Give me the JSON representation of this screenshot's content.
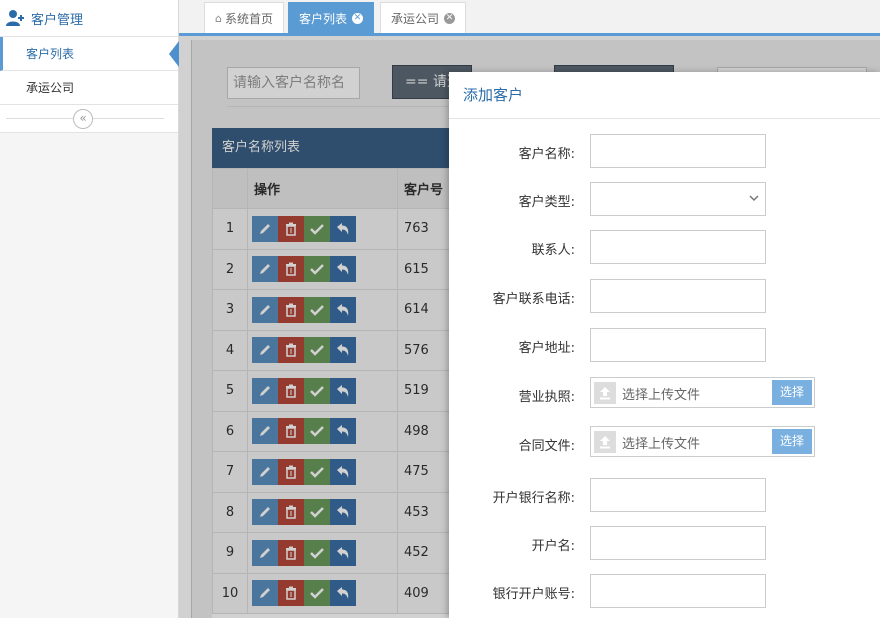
{
  "sidebar": {
    "header": "客户管理",
    "items": [
      {
        "label": "客户列表",
        "active": true
      },
      {
        "label": "承运公司",
        "active": false
      }
    ],
    "collapse_glyph": "«"
  },
  "tabs": [
    {
      "label": "系统首页",
      "icon": "home-icon"
    },
    {
      "label": "客户列表",
      "active": true
    },
    {
      "label": "承运公司"
    }
  ],
  "toolbar": {
    "search_placeholder": "请输入客户名称名",
    "query_label": "== 请选"
  },
  "table": {
    "title": "客户名称列表",
    "headers": [
      "",
      "操作",
      "客户号"
    ],
    "rows": [
      {
        "no": "1",
        "id": "763"
      },
      {
        "no": "2",
        "id": "615"
      },
      {
        "no": "3",
        "id": "614"
      },
      {
        "no": "4",
        "id": "576"
      },
      {
        "no": "5",
        "id": "519"
      },
      {
        "no": "6",
        "id": "498"
      },
      {
        "no": "7",
        "id": "475"
      },
      {
        "no": "8",
        "id": "453"
      },
      {
        "no": "9",
        "id": "452"
      },
      {
        "no": "10",
        "id": "409"
      }
    ]
  },
  "modal": {
    "title": "添加客户",
    "fields": [
      {
        "label": "客户名称:",
        "type": "text"
      },
      {
        "label": "客户类型:",
        "type": "select"
      },
      {
        "label": "联系人:",
        "type": "text"
      },
      {
        "label": "客户联系电话:",
        "type": "text"
      },
      {
        "label": "客户地址:",
        "type": "text"
      },
      {
        "label": "营业执照:",
        "type": "upload",
        "placeholder": "选择上传文件",
        "button": "选择"
      },
      {
        "label": "合同文件:",
        "type": "upload",
        "placeholder": "选择上传文件",
        "button": "选择"
      },
      {
        "label": "开户银行名称:",
        "type": "text"
      },
      {
        "label": "开户名:",
        "type": "text"
      },
      {
        "label": "银行开户账号:",
        "type": "text"
      }
    ]
  },
  "colors": {
    "accent": "#5b9bd3",
    "panel_head": "#3a5f86",
    "edit": "#5b8fbf",
    "delete": "#b5473a",
    "approve": "#6a9b5c",
    "revert": "#3b6ea5"
  }
}
